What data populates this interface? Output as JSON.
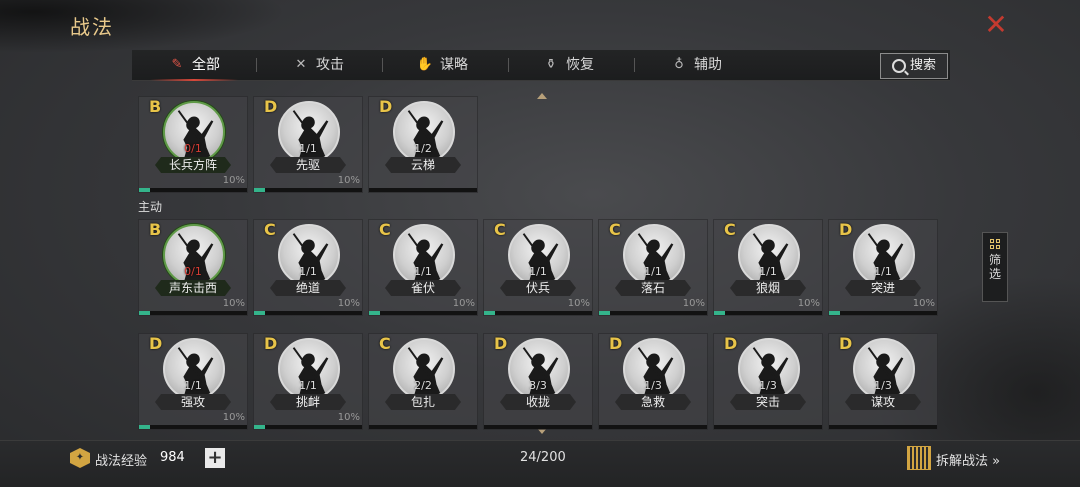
{
  "header": {
    "title": "战法"
  },
  "tabs": [
    {
      "label": "全部",
      "icon": "scroll-icon",
      "active": true
    },
    {
      "label": "攻击",
      "icon": "crossed-swords-icon",
      "active": false
    },
    {
      "label": "谋略",
      "icon": "hand-icon",
      "active": false
    },
    {
      "label": "恢复",
      "icon": "medicine-pot-icon",
      "active": false
    },
    {
      "label": "辅助",
      "icon": "bag-icon",
      "active": false
    }
  ],
  "search": {
    "label": "搜索"
  },
  "section_label": "主动",
  "filter": {
    "label1": "筛",
    "label2": "选"
  },
  "cards": [
    {
      "grade": "B",
      "level": "0/1",
      "name": "长兵方阵",
      "pct": "10%",
      "fill": 0.1
    },
    {
      "grade": "D",
      "level": "1/1",
      "name": "先驱",
      "pct": "10%",
      "fill": 0.1
    },
    {
      "grade": "D",
      "level": "1/2",
      "name": "云梯",
      "pct": "",
      "fill": 0
    },
    {
      "grade": "B",
      "level": "0/1",
      "name": "声东击西",
      "pct": "10%",
      "fill": 0.1
    },
    {
      "grade": "C",
      "level": "1/1",
      "name": "绝道",
      "pct": "10%",
      "fill": 0.1
    },
    {
      "grade": "C",
      "level": "1/1",
      "name": "雀伏",
      "pct": "10%",
      "fill": 0.1
    },
    {
      "grade": "C",
      "level": "1/1",
      "name": "伏兵",
      "pct": "10%",
      "fill": 0.1
    },
    {
      "grade": "C",
      "level": "1/1",
      "name": "落石",
      "pct": "10%",
      "fill": 0.1
    },
    {
      "grade": "C",
      "level": "1/1",
      "name": "狼烟",
      "pct": "10%",
      "fill": 0.1
    },
    {
      "grade": "D",
      "level": "1/1",
      "name": "突进",
      "pct": "10%",
      "fill": 0.1
    },
    {
      "grade": "D",
      "level": "1/1",
      "name": "强攻",
      "pct": "10%",
      "fill": 0.1
    },
    {
      "grade": "D",
      "level": "1/1",
      "name": "挑衅",
      "pct": "10%",
      "fill": 0.1
    },
    {
      "grade": "C",
      "level": "2/2",
      "name": "包扎",
      "pct": "",
      "fill": 0
    },
    {
      "grade": "D",
      "level": "3/3",
      "name": "收拢",
      "pct": "",
      "fill": 0
    },
    {
      "grade": "D",
      "level": "1/3",
      "name": "急救",
      "pct": "",
      "fill": 0
    },
    {
      "grade": "D",
      "level": "1/3",
      "name": "突击",
      "pct": "",
      "fill": 0
    },
    {
      "grade": "D",
      "level": "1/3",
      "name": "谋攻",
      "pct": "",
      "fill": 0
    }
  ],
  "footer": {
    "exp_label": "战法经验",
    "exp_value": "984",
    "plus": "+",
    "count": "24/200",
    "decompose_label": "拆解战法 »"
  }
}
